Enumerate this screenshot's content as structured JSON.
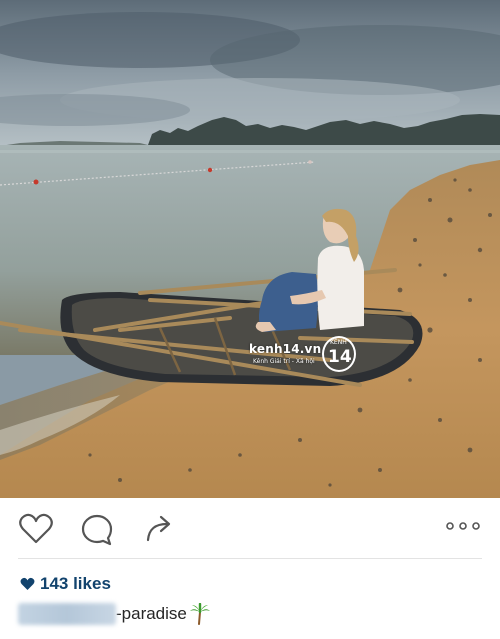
{
  "post": {
    "watermark": {
      "site": "kenh14.vn",
      "tagline": "Kênh Giải trí - Xã hội",
      "badge_top": "KÊNH",
      "badge_number": "14"
    },
    "actions": {
      "like_icon": "heart-outline-icon",
      "comment_icon": "speech-bubble-icon",
      "share_icon": "share-arrow-icon",
      "more_icon": "more-dots-icon"
    },
    "likes_text": "143 likes",
    "caption": {
      "text": "-paradise",
      "emoji_icon": "palm-tree-icon"
    },
    "colors": {
      "likes": "#12436d",
      "icon_stroke": "#555555"
    }
  }
}
